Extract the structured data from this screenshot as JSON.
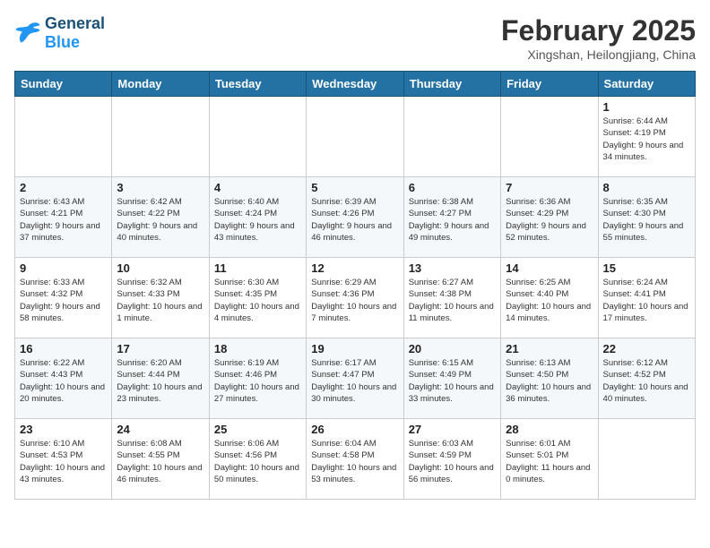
{
  "header": {
    "logo_general": "General",
    "logo_blue": "Blue",
    "month": "February 2025",
    "location": "Xingshan, Heilongjiang, China"
  },
  "weekdays": [
    "Sunday",
    "Monday",
    "Tuesday",
    "Wednesday",
    "Thursday",
    "Friday",
    "Saturday"
  ],
  "weeks": [
    [
      {
        "day": "",
        "info": ""
      },
      {
        "day": "",
        "info": ""
      },
      {
        "day": "",
        "info": ""
      },
      {
        "day": "",
        "info": ""
      },
      {
        "day": "",
        "info": ""
      },
      {
        "day": "",
        "info": ""
      },
      {
        "day": "1",
        "info": "Sunrise: 6:44 AM\nSunset: 4:19 PM\nDaylight: 9 hours and 34 minutes."
      }
    ],
    [
      {
        "day": "2",
        "info": "Sunrise: 6:43 AM\nSunset: 4:21 PM\nDaylight: 9 hours and 37 minutes."
      },
      {
        "day": "3",
        "info": "Sunrise: 6:42 AM\nSunset: 4:22 PM\nDaylight: 9 hours and 40 minutes."
      },
      {
        "day": "4",
        "info": "Sunrise: 6:40 AM\nSunset: 4:24 PM\nDaylight: 9 hours and 43 minutes."
      },
      {
        "day": "5",
        "info": "Sunrise: 6:39 AM\nSunset: 4:26 PM\nDaylight: 9 hours and 46 minutes."
      },
      {
        "day": "6",
        "info": "Sunrise: 6:38 AM\nSunset: 4:27 PM\nDaylight: 9 hours and 49 minutes."
      },
      {
        "day": "7",
        "info": "Sunrise: 6:36 AM\nSunset: 4:29 PM\nDaylight: 9 hours and 52 minutes."
      },
      {
        "day": "8",
        "info": "Sunrise: 6:35 AM\nSunset: 4:30 PM\nDaylight: 9 hours and 55 minutes."
      }
    ],
    [
      {
        "day": "9",
        "info": "Sunrise: 6:33 AM\nSunset: 4:32 PM\nDaylight: 9 hours and 58 minutes."
      },
      {
        "day": "10",
        "info": "Sunrise: 6:32 AM\nSunset: 4:33 PM\nDaylight: 10 hours and 1 minute."
      },
      {
        "day": "11",
        "info": "Sunrise: 6:30 AM\nSunset: 4:35 PM\nDaylight: 10 hours and 4 minutes."
      },
      {
        "day": "12",
        "info": "Sunrise: 6:29 AM\nSunset: 4:36 PM\nDaylight: 10 hours and 7 minutes."
      },
      {
        "day": "13",
        "info": "Sunrise: 6:27 AM\nSunset: 4:38 PM\nDaylight: 10 hours and 11 minutes."
      },
      {
        "day": "14",
        "info": "Sunrise: 6:25 AM\nSunset: 4:40 PM\nDaylight: 10 hours and 14 minutes."
      },
      {
        "day": "15",
        "info": "Sunrise: 6:24 AM\nSunset: 4:41 PM\nDaylight: 10 hours and 17 minutes."
      }
    ],
    [
      {
        "day": "16",
        "info": "Sunrise: 6:22 AM\nSunset: 4:43 PM\nDaylight: 10 hours and 20 minutes."
      },
      {
        "day": "17",
        "info": "Sunrise: 6:20 AM\nSunset: 4:44 PM\nDaylight: 10 hours and 23 minutes."
      },
      {
        "day": "18",
        "info": "Sunrise: 6:19 AM\nSunset: 4:46 PM\nDaylight: 10 hours and 27 minutes."
      },
      {
        "day": "19",
        "info": "Sunrise: 6:17 AM\nSunset: 4:47 PM\nDaylight: 10 hours and 30 minutes."
      },
      {
        "day": "20",
        "info": "Sunrise: 6:15 AM\nSunset: 4:49 PM\nDaylight: 10 hours and 33 minutes."
      },
      {
        "day": "21",
        "info": "Sunrise: 6:13 AM\nSunset: 4:50 PM\nDaylight: 10 hours and 36 minutes."
      },
      {
        "day": "22",
        "info": "Sunrise: 6:12 AM\nSunset: 4:52 PM\nDaylight: 10 hours and 40 minutes."
      }
    ],
    [
      {
        "day": "23",
        "info": "Sunrise: 6:10 AM\nSunset: 4:53 PM\nDaylight: 10 hours and 43 minutes."
      },
      {
        "day": "24",
        "info": "Sunrise: 6:08 AM\nSunset: 4:55 PM\nDaylight: 10 hours and 46 minutes."
      },
      {
        "day": "25",
        "info": "Sunrise: 6:06 AM\nSunset: 4:56 PM\nDaylight: 10 hours and 50 minutes."
      },
      {
        "day": "26",
        "info": "Sunrise: 6:04 AM\nSunset: 4:58 PM\nDaylight: 10 hours and 53 minutes."
      },
      {
        "day": "27",
        "info": "Sunrise: 6:03 AM\nSunset: 4:59 PM\nDaylight: 10 hours and 56 minutes."
      },
      {
        "day": "28",
        "info": "Sunrise: 6:01 AM\nSunset: 5:01 PM\nDaylight: 11 hours and 0 minutes."
      },
      {
        "day": "",
        "info": ""
      }
    ]
  ]
}
